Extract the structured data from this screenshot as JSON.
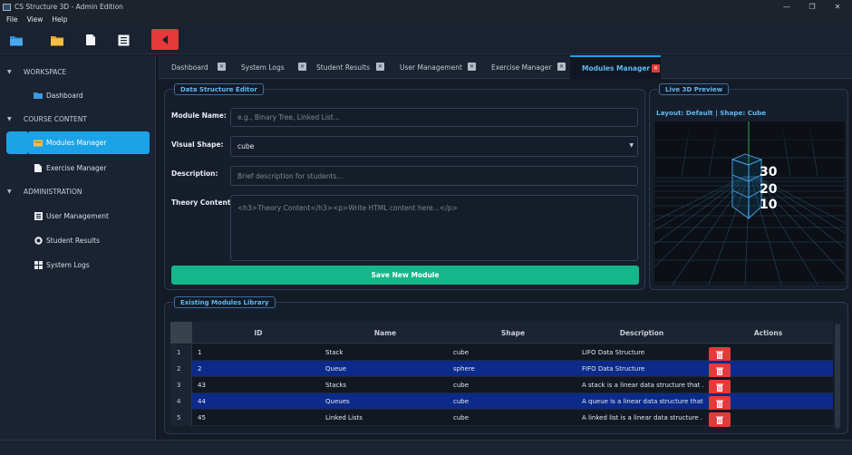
{
  "window": {
    "title": "CS Structure 3D - Admin Edition",
    "minimize": "—",
    "maximize": "❐",
    "close": "✕"
  },
  "menu": [
    "File",
    "View",
    "Help"
  ],
  "sidebar": {
    "sections": [
      {
        "label": "WORKSPACE",
        "items": [
          {
            "label": "Dashboard",
            "icon": "folder-icon"
          }
        ]
      },
      {
        "label": "COURSE CONTENT",
        "items": [
          {
            "label": "Modules Manager",
            "icon": "module-icon",
            "active": true
          },
          {
            "label": "Exercise Manager",
            "icon": "document-icon"
          }
        ]
      },
      {
        "label": "ADMINISTRATION",
        "items": [
          {
            "label": "User Management",
            "icon": "users-icon"
          },
          {
            "label": "Student Results",
            "icon": "results-icon"
          },
          {
            "label": "System Logs",
            "icon": "logs-icon"
          }
        ]
      }
    ]
  },
  "tabs": [
    {
      "label": "Dashboard"
    },
    {
      "label": "System Logs"
    },
    {
      "label": "Student Results"
    },
    {
      "label": "User Management"
    },
    {
      "label": "Exercise Manager"
    },
    {
      "label": "Modules Manager",
      "active": true
    }
  ],
  "editor": {
    "title": "Data Structure Editor",
    "module_name": {
      "label": "Module Name:",
      "placeholder": "e.g., Binary Tree, Linked List..."
    },
    "visual_shape": {
      "label": "Visual Shape:",
      "value": "cube"
    },
    "description": {
      "label": "Description:",
      "placeholder": "Brief description for students..."
    },
    "theory": {
      "label": "Theory Content:",
      "placeholder": "<h3>Theory Content</h3><p>Write HTML content here...</p>"
    },
    "save_label": "Save New Module"
  },
  "preview": {
    "title": "Live 3D Preview",
    "status": "Layout: Default | Shape: Cube",
    "stack_values": [
      "30",
      "20",
      "10"
    ]
  },
  "library": {
    "title": "Existing Modules Library",
    "columns": [
      "ID",
      "Name",
      "Shape",
      "Description",
      "Actions"
    ],
    "rows": [
      {
        "num": "1",
        "id": "1",
        "name": "Stack",
        "shape": "cube",
        "description": "LIFO Data Structure"
      },
      {
        "num": "2",
        "id": "2",
        "name": "Queue",
        "shape": "sphere",
        "description": "FIFO Data Structure"
      },
      {
        "num": "3",
        "id": "43",
        "name": "Stacks",
        "shape": "cube",
        "description": "A stack is a linear data structure that ..."
      },
      {
        "num": "4",
        "id": "44",
        "name": "Queues",
        "shape": "cube",
        "description": "A queue is a linear data structure that ..."
      },
      {
        "num": "5",
        "id": "45",
        "name": "Linked Lists",
        "shape": "cube",
        "description": "A linked list is a linear data structure ..."
      }
    ]
  },
  "colors": {
    "accent": "#1ba3e8",
    "save": "#14b68a",
    "danger": "#e5393b",
    "selected_row": "#0b2a8a"
  }
}
